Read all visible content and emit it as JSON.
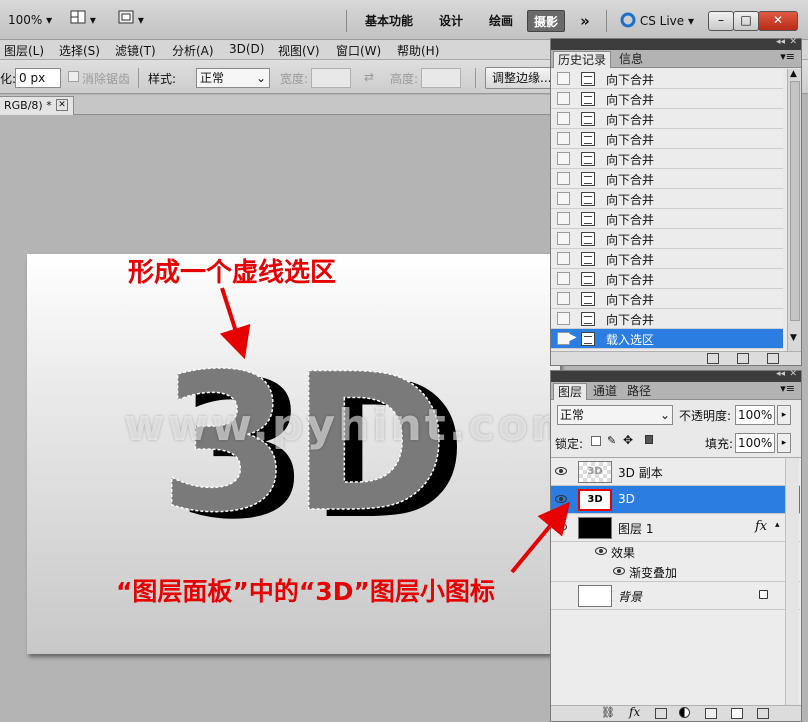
{
  "appbar": {
    "zoom": "100%",
    "workspaces": [
      "基本功能",
      "设计",
      "绘画",
      "摄影"
    ],
    "active_workspace": "摄影",
    "more": "»",
    "cslive": "CS Live",
    "win_min": "–",
    "win_max": "□",
    "win_close": "✕"
  },
  "menubar": {
    "items": [
      "图层(L)",
      "选择(S)",
      "滤镜(T)",
      "分析(A)",
      "3D(D)",
      "视图(V)",
      "窗口(W)",
      "帮助(H)"
    ]
  },
  "options": {
    "feather_label": "化:",
    "feather_value": "0 px",
    "antialias_label": "消除锯齿",
    "style_label": "样式:",
    "style_value": "正常",
    "width_label": "宽度:",
    "height_label": "高度:",
    "refine_edge": "调整边缘..."
  },
  "document": {
    "tab_label": "RGB/8) *",
    "tab_close": "✕"
  },
  "canvas": {
    "artwork_text": "3D",
    "watermark": "www.pyhint.com"
  },
  "history_panel": {
    "tabs": [
      "历史记录",
      "信息"
    ],
    "active_tab": "历史记录",
    "items": [
      "向下合并",
      "向下合并",
      "向下合并",
      "向下合并",
      "向下合并",
      "向下合并",
      "向下合并",
      "向下合并",
      "向下合并",
      "向下合并",
      "向下合并",
      "向下合并",
      "向下合并",
      "载入选区"
    ],
    "selected_index": 13
  },
  "layers_panel": {
    "tabs": [
      "图层",
      "通道",
      "路径"
    ],
    "active_tab": "图层",
    "blend_mode": "正常",
    "opacity_label": "不透明度:",
    "opacity_value": "100%",
    "lock_label": "锁定:",
    "fill_label": "填充:",
    "fill_value": "100%",
    "layers": [
      {
        "name": "3D 副本",
        "thumb_text": "3D",
        "selected": false
      },
      {
        "name": "3D",
        "thumb_text": "3D",
        "selected": true
      },
      {
        "name": "图层 1",
        "thumb_text": "",
        "selected": false,
        "fx": "fx"
      },
      {
        "name": "背景",
        "thumb_text": "",
        "selected": false
      }
    ],
    "effects_label": "效果",
    "effect_item": "渐变叠加"
  },
  "annotations": {
    "selection_note": "形成一个虚线选区",
    "layer_note": "“图层面板”中的“3D”图层小图标"
  },
  "colors": {
    "accent": "#2b7de1",
    "annotation": "#e60000",
    "art_fill": "#7a7a7a"
  }
}
